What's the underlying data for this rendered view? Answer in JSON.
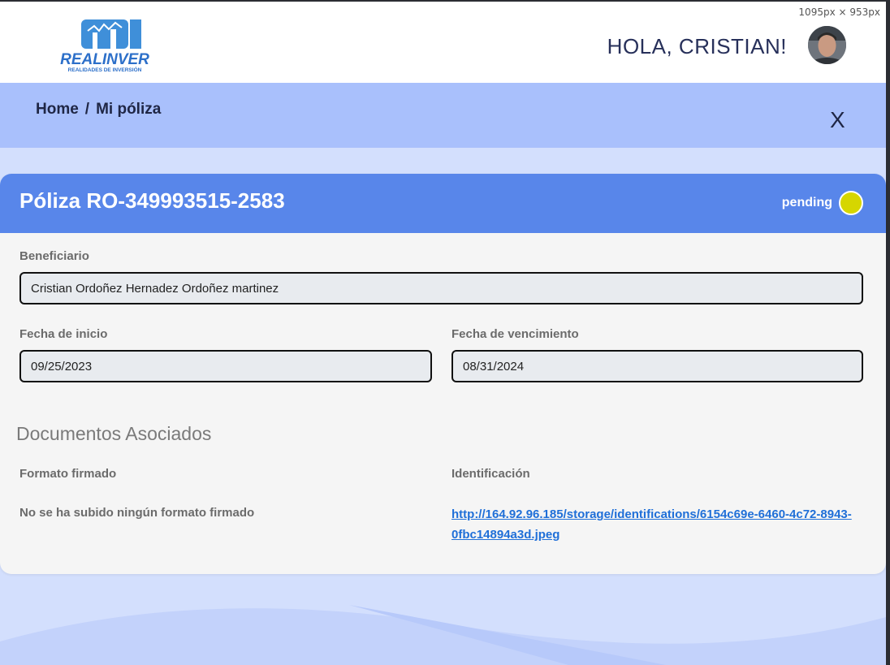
{
  "devtools": {
    "viewport_size": "1095px × 953px"
  },
  "header": {
    "logo_text": "REALINVER",
    "logo_tagline": "REALIDADES DE INVERSIÓN",
    "greeting": "HOLA, CRISTIAN!"
  },
  "breadcrumb": {
    "home": "Home",
    "separator": "/",
    "current": "Mi póliza",
    "close_label": "X"
  },
  "policy": {
    "title": "Póliza RO-349993515-2583",
    "status_label": "pending",
    "status_color": "#d6d600"
  },
  "fields": {
    "beneficiario_label": "Beneficiario",
    "beneficiario_value": "Cristian Ordoñez Hernadez Ordoñez martinez",
    "fecha_inicio_label": "Fecha de inicio",
    "fecha_inicio_value": "09/25/2023",
    "fecha_vencimiento_label": "Fecha de vencimiento",
    "fecha_vencimiento_value": "08/31/2024"
  },
  "documents": {
    "section_title": "Documentos Asociados",
    "formato_label": "Formato firmado",
    "formato_value": "No se ha subido ningún formato firmado",
    "identificacion_label": "Identificación",
    "identificacion_link": "http://164.92.96.185/storage/identifications/6154c69e-6460-4c72-8943-0fbc14894a3d.jpeg"
  },
  "colors": {
    "header_bg": "#ffffff",
    "crumb_bg": "#a9c0fc",
    "page_bg": "#d3dffd",
    "card_header_bg": "#5886ea",
    "link": "#1f6fd8"
  }
}
